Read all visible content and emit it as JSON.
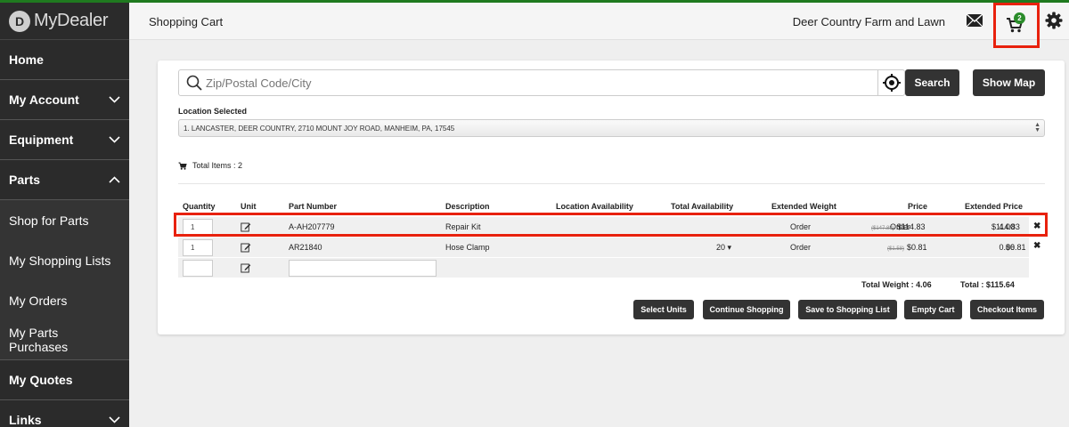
{
  "brand": {
    "logo_mark": "D",
    "name": "MyDealer"
  },
  "sidebar": {
    "items": [
      {
        "label": "Home",
        "chevron": ""
      },
      {
        "label": "My Account",
        "chevron": "chevron-down"
      },
      {
        "label": "Equipment",
        "chevron": "chevron-down"
      },
      {
        "label": "Parts",
        "chevron": "chevron-up"
      },
      {
        "label": "Shop for Parts",
        "sub": true
      },
      {
        "label": "My Shopping Lists",
        "sub": true
      },
      {
        "label": "My Orders",
        "sub": true
      },
      {
        "label": "My Parts Purchases",
        "sub": true
      },
      {
        "label": "My Quotes",
        "chevron": ""
      },
      {
        "label": "Links",
        "chevron": "chevron-down"
      }
    ]
  },
  "header": {
    "title": "Shopping Cart",
    "dealer": "Deer Country Farm and Lawn",
    "cart_count": "2",
    "icons": [
      "mail-icon",
      "cart-icon",
      "gear-icon"
    ]
  },
  "search": {
    "placeholder": "Zip/Postal Code/City",
    "value": "",
    "search_label": "Search",
    "map_label": "Show Map"
  },
  "location": {
    "label": "Location Selected",
    "selected": "1. LANCASTER, DEER COUNTRY, 2710 MOUNT JOY ROAD, MANHEIM, PA, 17545"
  },
  "cart": {
    "total_items_label": "Total Items : 2",
    "columns": [
      "Quantity",
      "Unit",
      "Part Number",
      "Description",
      "Location Availability",
      "Total Availability",
      "Extended Weight",
      "Price",
      "Extended Price"
    ],
    "rows": [
      {
        "qty": "1",
        "part_number": "A-AH207779",
        "description": "Repair Kit",
        "location_availability": "Order",
        "total_availability": "Order",
        "extended_weight": "4.00",
        "list_price": "($147.88)",
        "price": "$114.83",
        "extended_price": "$114.83",
        "remove": "✖"
      },
      {
        "qty": "1",
        "part_number": "AR21840",
        "description": "Hose Clamp",
        "location_availability": "Order",
        "total_availability": "20",
        "total_availability_caret": "▾",
        "extended_weight": "0.06",
        "list_price": "($1.58)",
        "price": "$0.81",
        "extended_price": "$0.81",
        "remove": "✖"
      }
    ],
    "total_weight_label": "Total Weight :  4.06",
    "total_label": "Total :  $115.64"
  },
  "actions": [
    "Select Units",
    "Continue Shopping",
    "Save to Shopping List",
    "Empty Cart",
    "Checkout Items"
  ],
  "colors": {
    "highlight": "#e8210d",
    "badge": "#2a8c2a",
    "sidebar": "#2b2b2b",
    "button": "#333333"
  }
}
